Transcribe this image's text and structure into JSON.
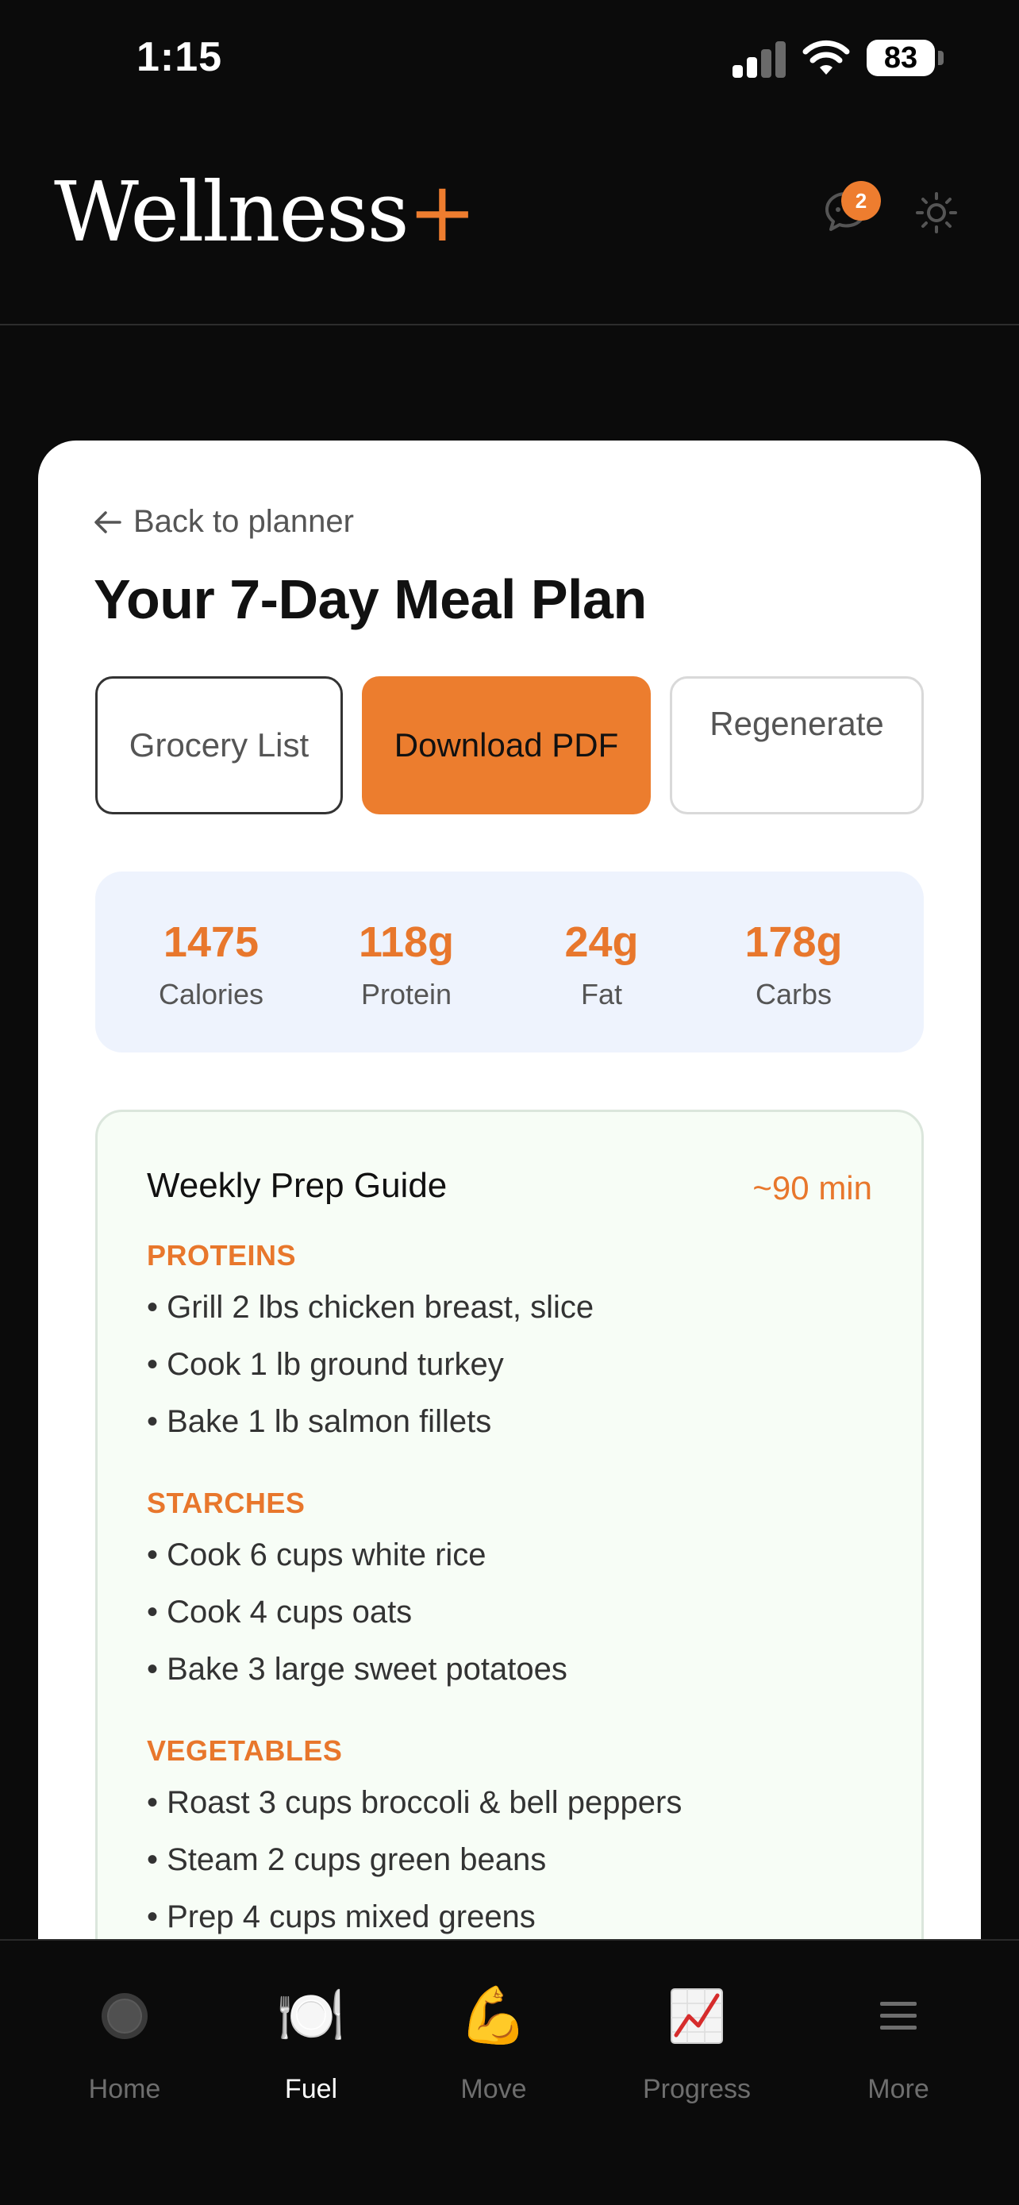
{
  "status_bar": {
    "time": "1:15",
    "battery": "83"
  },
  "header": {
    "logo_text": "Wellness",
    "logo_plus": "+",
    "chat_badge": "2"
  },
  "card": {
    "back_label": "Back to planner",
    "title": "Your 7-Day Meal Plan",
    "buttons": {
      "grocery": "Grocery List",
      "download": "Download PDF",
      "regenerate": "Regenerate"
    },
    "macros": [
      {
        "value": "1475",
        "label": "Calories"
      },
      {
        "value": "118g",
        "label": "Protein"
      },
      {
        "value": "24g",
        "label": "Fat"
      },
      {
        "value": "178g",
        "label": "Carbs"
      }
    ],
    "prep_guide": {
      "title": "Weekly Prep Guide",
      "time": "~90 min",
      "sections": [
        {
          "title": "PROTEINS",
          "items": [
            "• Grill 2 lbs chicken breast, slice",
            "• Cook 1 lb ground turkey",
            "• Bake 1 lb salmon fillets"
          ]
        },
        {
          "title": "STARCHES",
          "items": [
            "• Cook 6 cups white rice",
            "• Cook 4 cups oats",
            "• Bake 3 large sweet potatoes"
          ]
        },
        {
          "title": "VEGETABLES",
          "items": [
            "• Roast 3 cups broccoli & bell peppers",
            "• Steam 2 cups green beans",
            "• Prep 4 cups mixed greens"
          ]
        }
      ]
    }
  },
  "nav": [
    {
      "label": "Home",
      "icon": "home-circle-icon"
    },
    {
      "label": "Fuel",
      "icon": "plate-icon",
      "glyph": "🍽️",
      "active": true
    },
    {
      "label": "Move",
      "icon": "flexed-biceps-icon",
      "glyph": "💪"
    },
    {
      "label": "Progress",
      "icon": "chart-increasing-icon"
    },
    {
      "label": "More",
      "icon": "menu-icon"
    }
  ],
  "colors": {
    "accent": "#ee7d2f",
    "background": "#0b0b0b",
    "card": "#ffffff",
    "macro_bg": "#eef3fd",
    "prep_bg": "#f7fdf6"
  }
}
